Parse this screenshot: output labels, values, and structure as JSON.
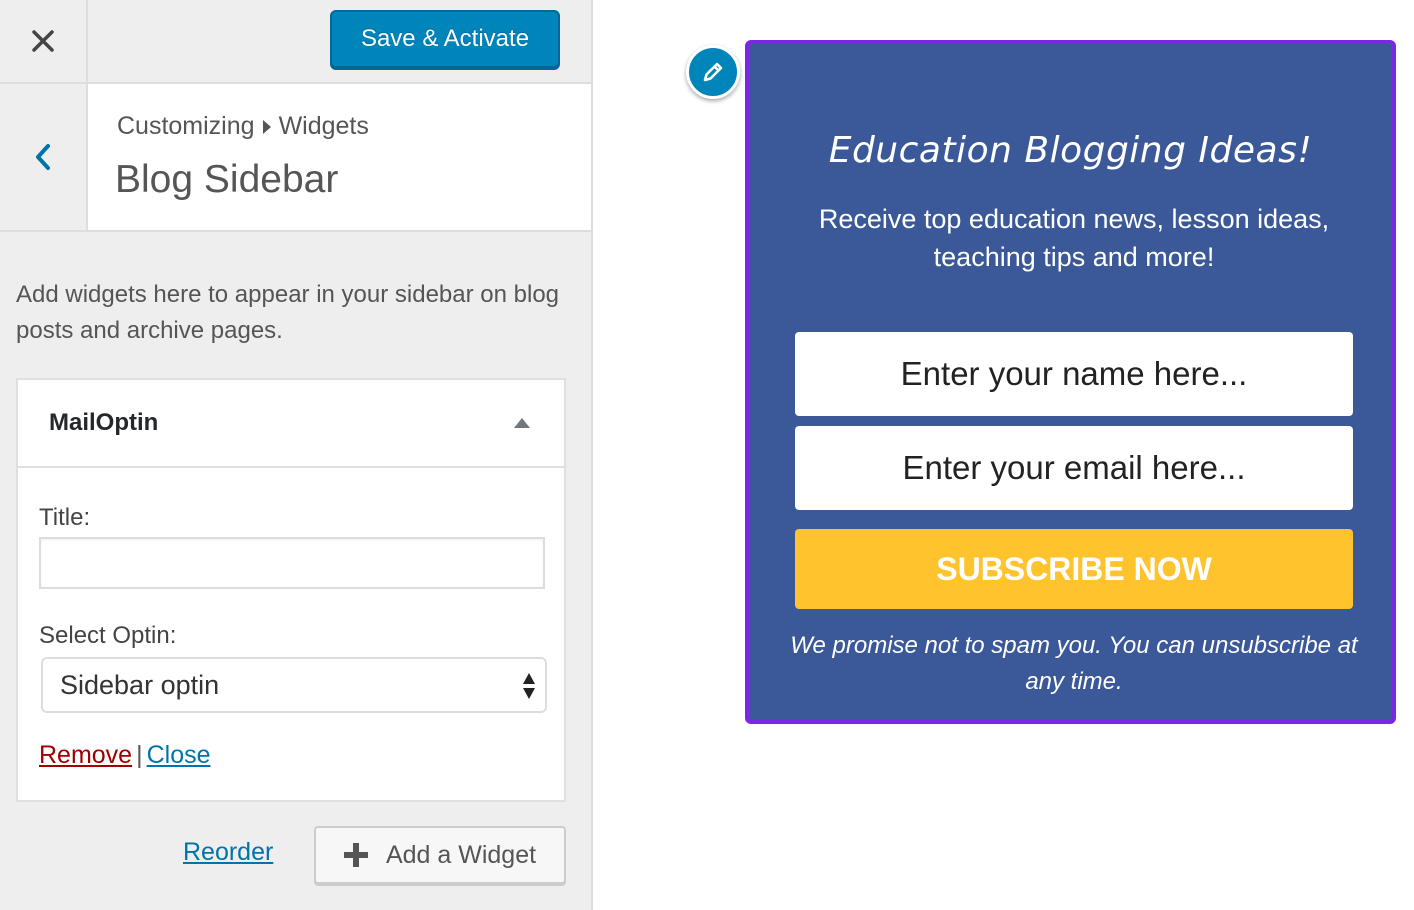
{
  "topbar": {
    "close_icon": "close-icon",
    "save_label": "Save & Activate"
  },
  "section": {
    "back_icon": "chevron-left-icon",
    "breadcrumb_root": "Customizing",
    "breadcrumb_current": "Widgets",
    "title": "Blog Sidebar",
    "description": "Add widgets here to appear in your sidebar on blog posts and archive pages."
  },
  "widget": {
    "name": "MailOptin",
    "title_label": "Title:",
    "title_value": "",
    "select_label": "Select Optin:",
    "select_value": "Sidebar optin",
    "remove_label": "Remove",
    "separator": "|",
    "close_label": "Close"
  },
  "footer": {
    "reorder_label": "Reorder",
    "add_widget_label": "Add a Widget"
  },
  "optin": {
    "headline": "Education Blogging Ideas!",
    "description": "Receive top education news, lesson ideas, teaching tips and more!",
    "name_placeholder": "Enter your name here...",
    "email_placeholder": "Enter your email here...",
    "button_label": "SUBSCRIBE NOW",
    "note": "We promise not to spam you. You can unsubscribe at any time."
  },
  "colors": {
    "accent": "#0085ba",
    "optin_background": "#3b5998",
    "optin_border": "#7d26e8",
    "subscribe_button": "#fec32d",
    "remove_link": "#a00000"
  }
}
